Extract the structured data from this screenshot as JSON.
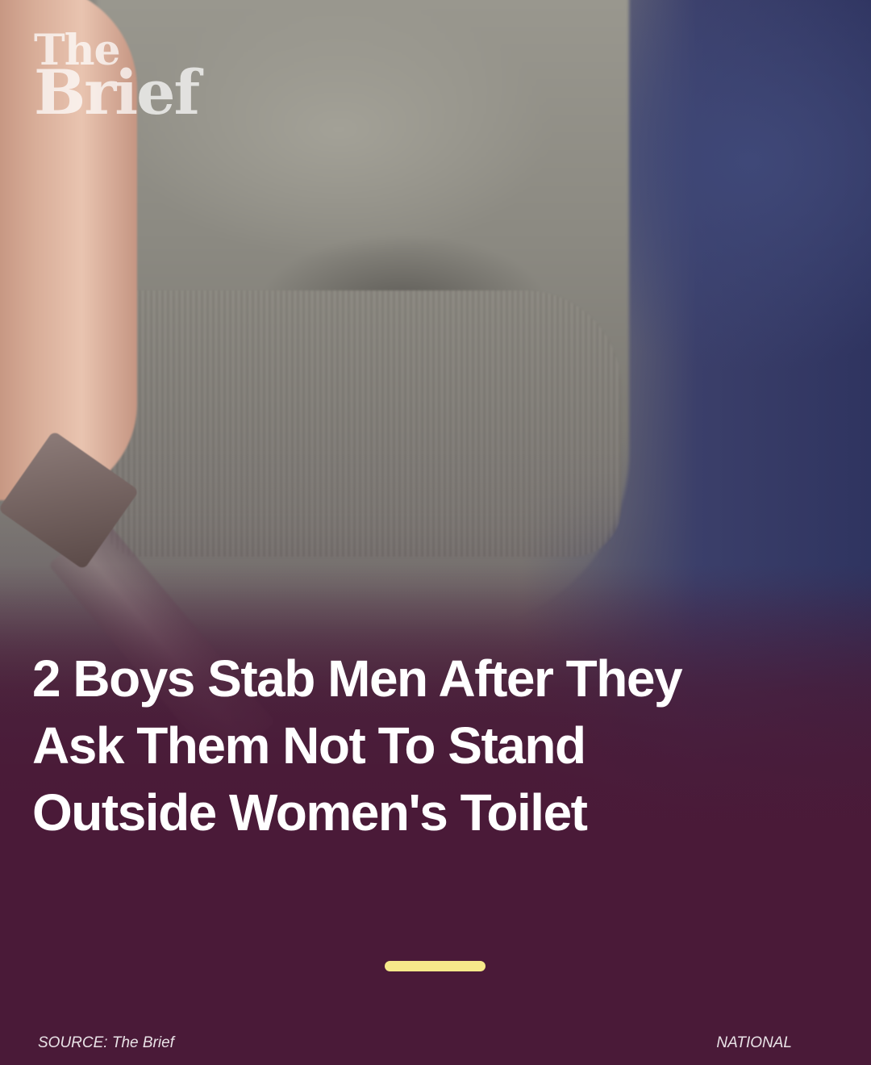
{
  "logo": {
    "line1": "The",
    "line2": "Brief"
  },
  "headline": "2 Boys Stab Men After They Ask Them Not To Stand Outside Women's Toilet",
  "footer": {
    "source": "SOURCE: The Brief",
    "category": "NATIONAL"
  },
  "colors": {
    "background": "#4a1a38",
    "indicator": "#f6e98a",
    "text": "#ffffff"
  }
}
